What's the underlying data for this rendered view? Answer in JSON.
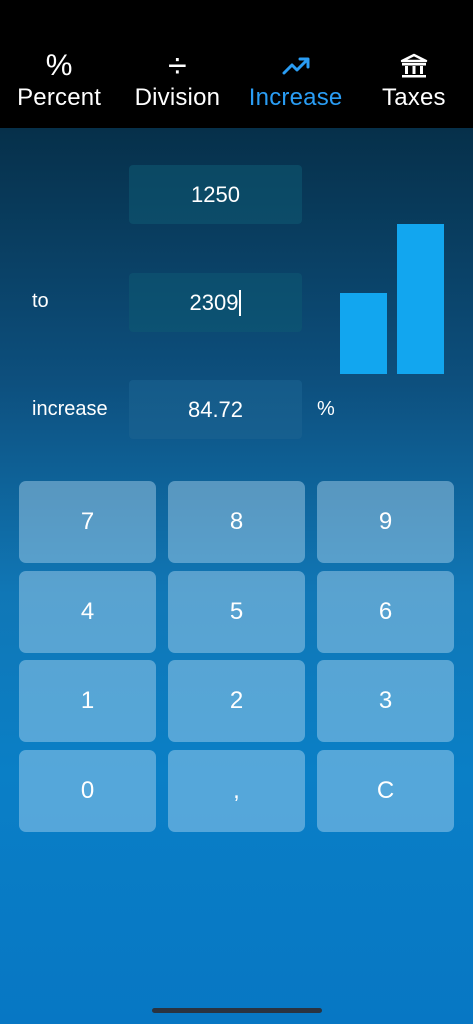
{
  "tabs": [
    {
      "id": "percent",
      "icon_glyph": "%",
      "icon_name": "percent-icon",
      "label": "Percent",
      "active": false
    },
    {
      "id": "division",
      "icon_glyph": "÷",
      "icon_name": "division-icon",
      "label": "Division",
      "active": false
    },
    {
      "id": "increase",
      "icon_glyph": "",
      "icon_name": "trending-up-icon",
      "label": "Increase",
      "active": true
    },
    {
      "id": "taxes",
      "icon_glyph": "",
      "icon_name": "bank-icon",
      "label": "Taxes",
      "active": false
    }
  ],
  "form": {
    "from_value": "1250",
    "to_label": "to",
    "to_value": "2309",
    "increase_label": "increase",
    "increase_value": "84.72",
    "unit": "%"
  },
  "chart_data": {
    "type": "bar",
    "categories": [
      "",
      ""
    ],
    "values": [
      1250,
      2309
    ],
    "color": "#12a6ef"
  },
  "keypad": {
    "keys": [
      "7",
      "8",
      "9",
      "4",
      "5",
      "6",
      "1",
      "2",
      "3",
      "0",
      ",",
      "C"
    ]
  },
  "colors": {
    "accent": "#2a9df4",
    "bar": "#12a6ef",
    "tabbar_bg": "#000000"
  }
}
